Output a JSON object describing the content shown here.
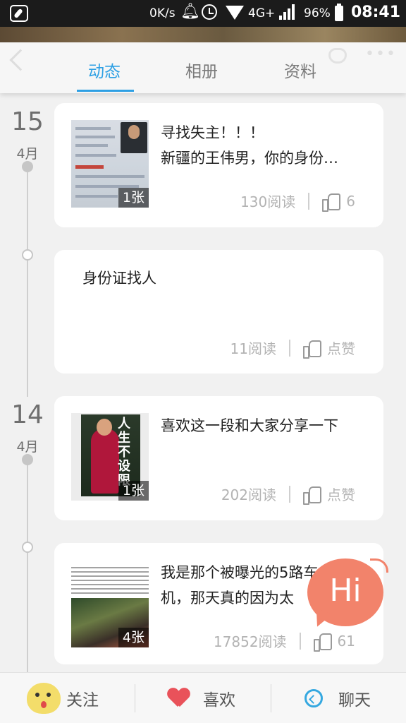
{
  "status_bar": {
    "speed": "0K/s",
    "network": "4G+",
    "battery_percent": "96%",
    "time": "08:41"
  },
  "tabs": [
    {
      "label": "动态",
      "active": true
    },
    {
      "label": "相册",
      "active": false
    },
    {
      "label": "资料",
      "active": false
    }
  ],
  "timeline": [
    {
      "day": "15",
      "month": "4月"
    },
    {
      "day": "14",
      "month": "4月"
    }
  ],
  "posts": [
    {
      "title": "寻找失主！！！",
      "desc": "新疆的王伟男，你的身份…",
      "image_count": "1张",
      "reads": "130阅读",
      "likes": "6"
    },
    {
      "title": "身份证找人",
      "desc": "",
      "image_count": "",
      "reads": "11阅读",
      "likes": "点赞"
    },
    {
      "title": "喜欢这一段和大家分享一下",
      "desc": "",
      "image_count": "1张",
      "reads": "202阅读",
      "likes": "点赞",
      "cover_title": "人生不设限"
    },
    {
      "title": "我是那个被曝光的5路车",
      "desc": "机，那天真的因为太",
      "image_count": "4张",
      "reads": "17852阅读",
      "likes": "61"
    }
  ],
  "hi_bubble": "Hi",
  "bottom_bar": {
    "follow": "关注",
    "like": "喜欢",
    "chat": "聊天"
  },
  "colors": {
    "accent": "#2ea0e4",
    "hi": "#f2836b",
    "heart": "#e9525a"
  }
}
